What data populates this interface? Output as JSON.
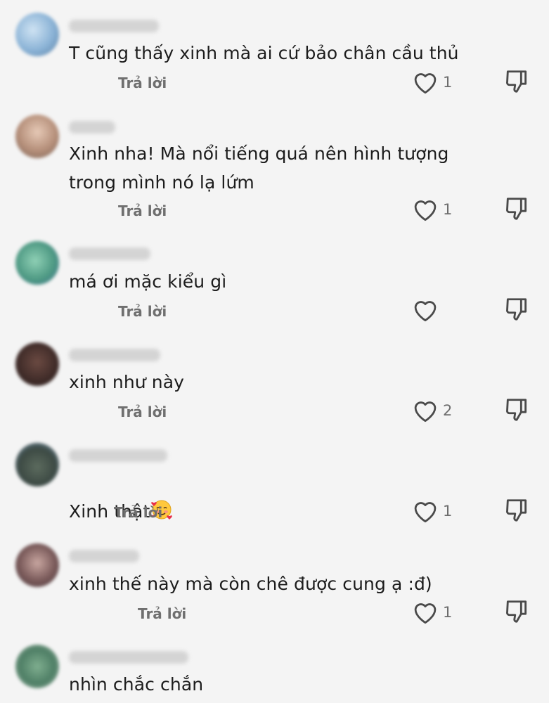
{
  "comments": [
    {
      "text": "T cũng thấy xinh mà ai cứ bảo chân cầu thủ",
      "reply": "Trả lời",
      "likes": "1"
    },
    {
      "text": "Xinh nha! Mà nổi tiếng quá nên hình tượng\ntrong mình nó lạ lứm",
      "reply": "Trả lời",
      "likes": "1"
    },
    {
      "text": "má ơi mặc kiểu gì",
      "reply": "Trả lời",
      "likes": ""
    },
    {
      "text": "xinh như này",
      "reply": "Trả lời",
      "likes": "2"
    },
    {
      "text": "Xinh thật",
      "reply": "Trả lời",
      "likes": "1"
    },
    {
      "text": "xinh thế này mà còn chê được cung ạ :đ)",
      "reply": "Trả lời",
      "likes": "1"
    },
    {
      "text": "nhìn chắc chắn",
      "reply": "",
      "likes": ""
    }
  ],
  "icons": {
    "like": "heart-outline-icon",
    "dislike": "thumbs-down-outline-icon",
    "emoji": "smiling-face-with-hearts-emoji"
  },
  "colors": {
    "background": "#f4f4f4",
    "text": "#1c1c1c",
    "muted": "#6f6f6f"
  }
}
